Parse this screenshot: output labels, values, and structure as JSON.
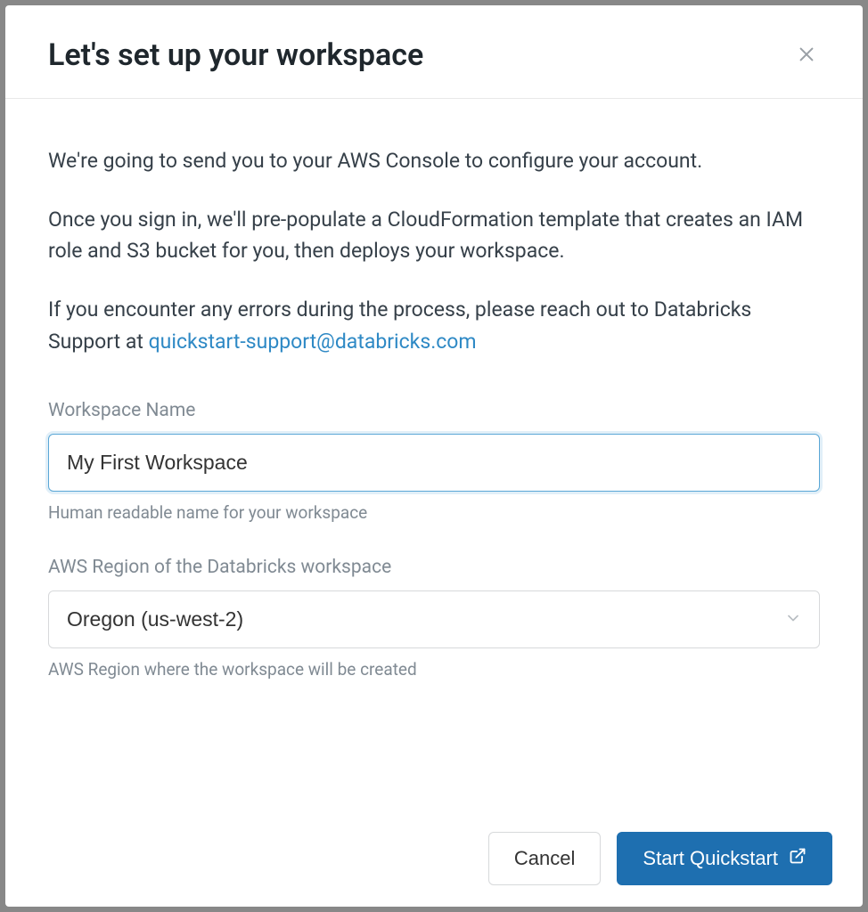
{
  "modal": {
    "title": "Let's set up your workspace",
    "intro": {
      "p1": "We're going to send you to your AWS Console to configure your account.",
      "p2": "Once you sign in, we'll pre-populate a CloudFormation template that creates an IAM role and S3 bucket for you, then deploys your workspace.",
      "p3_prefix": "If you encounter any errors during the process, please reach out to Databricks Support at ",
      "support_email": "quickstart-support@databricks.com"
    },
    "form": {
      "workspace_name": {
        "label": "Workspace Name",
        "value": "My First Workspace",
        "help": "Human readable name for your workspace"
      },
      "region": {
        "label": "AWS Region of the Databricks workspace",
        "selected": "Oregon (us-west-2)",
        "help": "AWS Region where the workspace will be created"
      }
    },
    "footer": {
      "cancel": "Cancel",
      "start": "Start Quickstart"
    }
  }
}
